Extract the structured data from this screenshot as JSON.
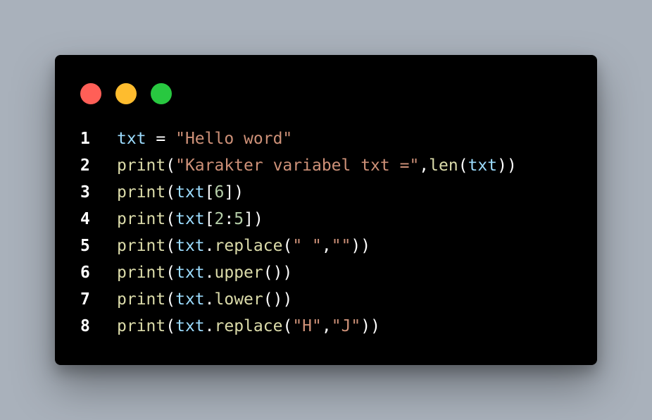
{
  "colors": {
    "page_background": "#a9b1bb",
    "window_background": "#000000",
    "dot_red": "#ff5f57",
    "dot_yellow": "#febc2e",
    "dot_green": "#28c840",
    "function": "#dcdcaa",
    "variable": "#9cdcfe",
    "string": "#ce9178",
    "number": "#b5cea8",
    "punctuation": "#ffffff",
    "line_number": "#ffffff"
  },
  "window_controls": [
    {
      "name": "close",
      "color": "#ff5f57"
    },
    {
      "name": "minimize",
      "color": "#febc2e"
    },
    {
      "name": "maximize",
      "color": "#28c840"
    }
  ],
  "code": {
    "lines": [
      {
        "number": "1",
        "tokens": [
          {
            "t": "var",
            "text": "txt"
          },
          {
            "t": "op",
            "text": " = "
          },
          {
            "t": "str",
            "text": "\"Hello word\""
          }
        ]
      },
      {
        "number": "2",
        "tokens": [
          {
            "t": "fn",
            "text": "print"
          },
          {
            "t": "punc",
            "text": "("
          },
          {
            "t": "str",
            "text": "\"Karakter variabel txt =\""
          },
          {
            "t": "punc",
            "text": ","
          },
          {
            "t": "fn",
            "text": "len"
          },
          {
            "t": "punc",
            "text": "("
          },
          {
            "t": "var",
            "text": "txt"
          },
          {
            "t": "punc",
            "text": "))"
          }
        ]
      },
      {
        "number": "3",
        "tokens": [
          {
            "t": "fn",
            "text": "print"
          },
          {
            "t": "punc",
            "text": "("
          },
          {
            "t": "var",
            "text": "txt"
          },
          {
            "t": "punc",
            "text": "["
          },
          {
            "t": "num",
            "text": "6"
          },
          {
            "t": "punc",
            "text": "])"
          }
        ]
      },
      {
        "number": "4",
        "tokens": [
          {
            "t": "fn",
            "text": "print"
          },
          {
            "t": "punc",
            "text": "("
          },
          {
            "t": "var",
            "text": "txt"
          },
          {
            "t": "punc",
            "text": "["
          },
          {
            "t": "num",
            "text": "2"
          },
          {
            "t": "punc",
            "text": ":"
          },
          {
            "t": "num",
            "text": "5"
          },
          {
            "t": "punc",
            "text": "])"
          }
        ]
      },
      {
        "number": "5",
        "tokens": [
          {
            "t": "fn",
            "text": "print"
          },
          {
            "t": "punc",
            "text": "("
          },
          {
            "t": "var",
            "text": "txt"
          },
          {
            "t": "punc",
            "text": "."
          },
          {
            "t": "fn",
            "text": "replace"
          },
          {
            "t": "punc",
            "text": "("
          },
          {
            "t": "str",
            "text": "\" \""
          },
          {
            "t": "punc",
            "text": ","
          },
          {
            "t": "str",
            "text": "\"\""
          },
          {
            "t": "punc",
            "text": "))"
          }
        ]
      },
      {
        "number": "6",
        "tokens": [
          {
            "t": "fn",
            "text": "print"
          },
          {
            "t": "punc",
            "text": "("
          },
          {
            "t": "var",
            "text": "txt"
          },
          {
            "t": "punc",
            "text": "."
          },
          {
            "t": "fn",
            "text": "upper"
          },
          {
            "t": "punc",
            "text": "())"
          }
        ]
      },
      {
        "number": "7",
        "tokens": [
          {
            "t": "fn",
            "text": "print"
          },
          {
            "t": "punc",
            "text": "("
          },
          {
            "t": "var",
            "text": "txt"
          },
          {
            "t": "punc",
            "text": "."
          },
          {
            "t": "fn",
            "text": "lower"
          },
          {
            "t": "punc",
            "text": "())"
          }
        ]
      },
      {
        "number": "8",
        "tokens": [
          {
            "t": "fn",
            "text": "print"
          },
          {
            "t": "punc",
            "text": "("
          },
          {
            "t": "var",
            "text": "txt"
          },
          {
            "t": "punc",
            "text": "."
          },
          {
            "t": "fn",
            "text": "replace"
          },
          {
            "t": "punc",
            "text": "("
          },
          {
            "t": "str",
            "text": "\"H\""
          },
          {
            "t": "punc",
            "text": ","
          },
          {
            "t": "str",
            "text": "\"J\""
          },
          {
            "t": "punc",
            "text": "))"
          }
        ]
      }
    ]
  }
}
